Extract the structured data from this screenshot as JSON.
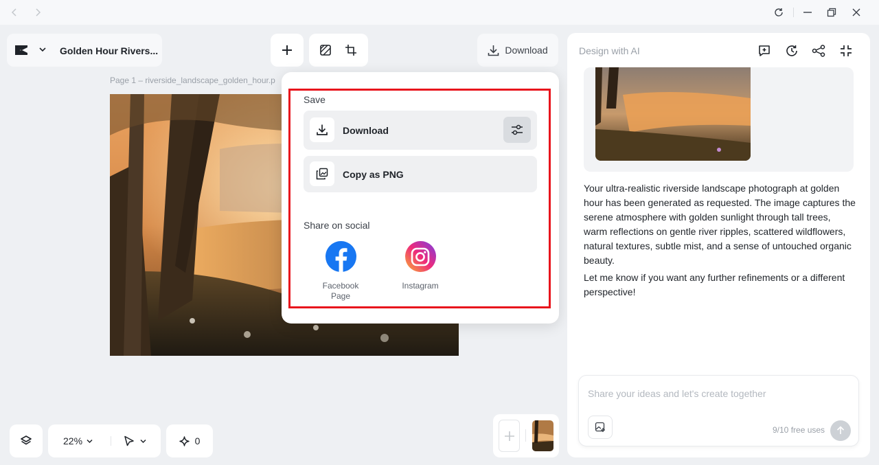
{
  "titlebar": {
    "back_icon": "chevron-left-icon",
    "forward_icon": "chevron-right-icon",
    "refresh_icon": "refresh-icon",
    "minimize_icon": "minimize-icon",
    "restore_icon": "restore-icon",
    "close_icon": "close-icon"
  },
  "header": {
    "logo_icon": "capcut-logo-icon",
    "project_title": "Golden Hour Rivers...",
    "download_label": "Download"
  },
  "canvas": {
    "page_label": "Page 1 –  riverside_landscape_golden_hour.p"
  },
  "popup": {
    "save_heading": "Save",
    "download_label": "Download",
    "copy_png_label": "Copy as PNG",
    "share_heading": "Share on social",
    "facebook_label": "Facebook Page",
    "instagram_label": "Instagram"
  },
  "right_panel": {
    "title": "Design with AI",
    "message_1": "Your ultra-realistic riverside landscape photograph at golden hour has been generated as requested. The image captures the serene atmosphere with golden sunlight through tall trees, warm reflections on gentle river ripples, scattered wildflowers, natural textures, subtle mist, and a sense of untouched organic beauty.",
    "message_2": "Let me know if you want any further refinements or a different perspective!",
    "chat_placeholder": "Share your ideas and let's create together",
    "free_uses": "9/10 free uses"
  },
  "bottom_toolbar": {
    "zoom": "22%",
    "credits": "0"
  },
  "colors": {
    "highlight_box": "#e8141c",
    "facebook": "#1877f2",
    "background": "#eef0f3"
  }
}
